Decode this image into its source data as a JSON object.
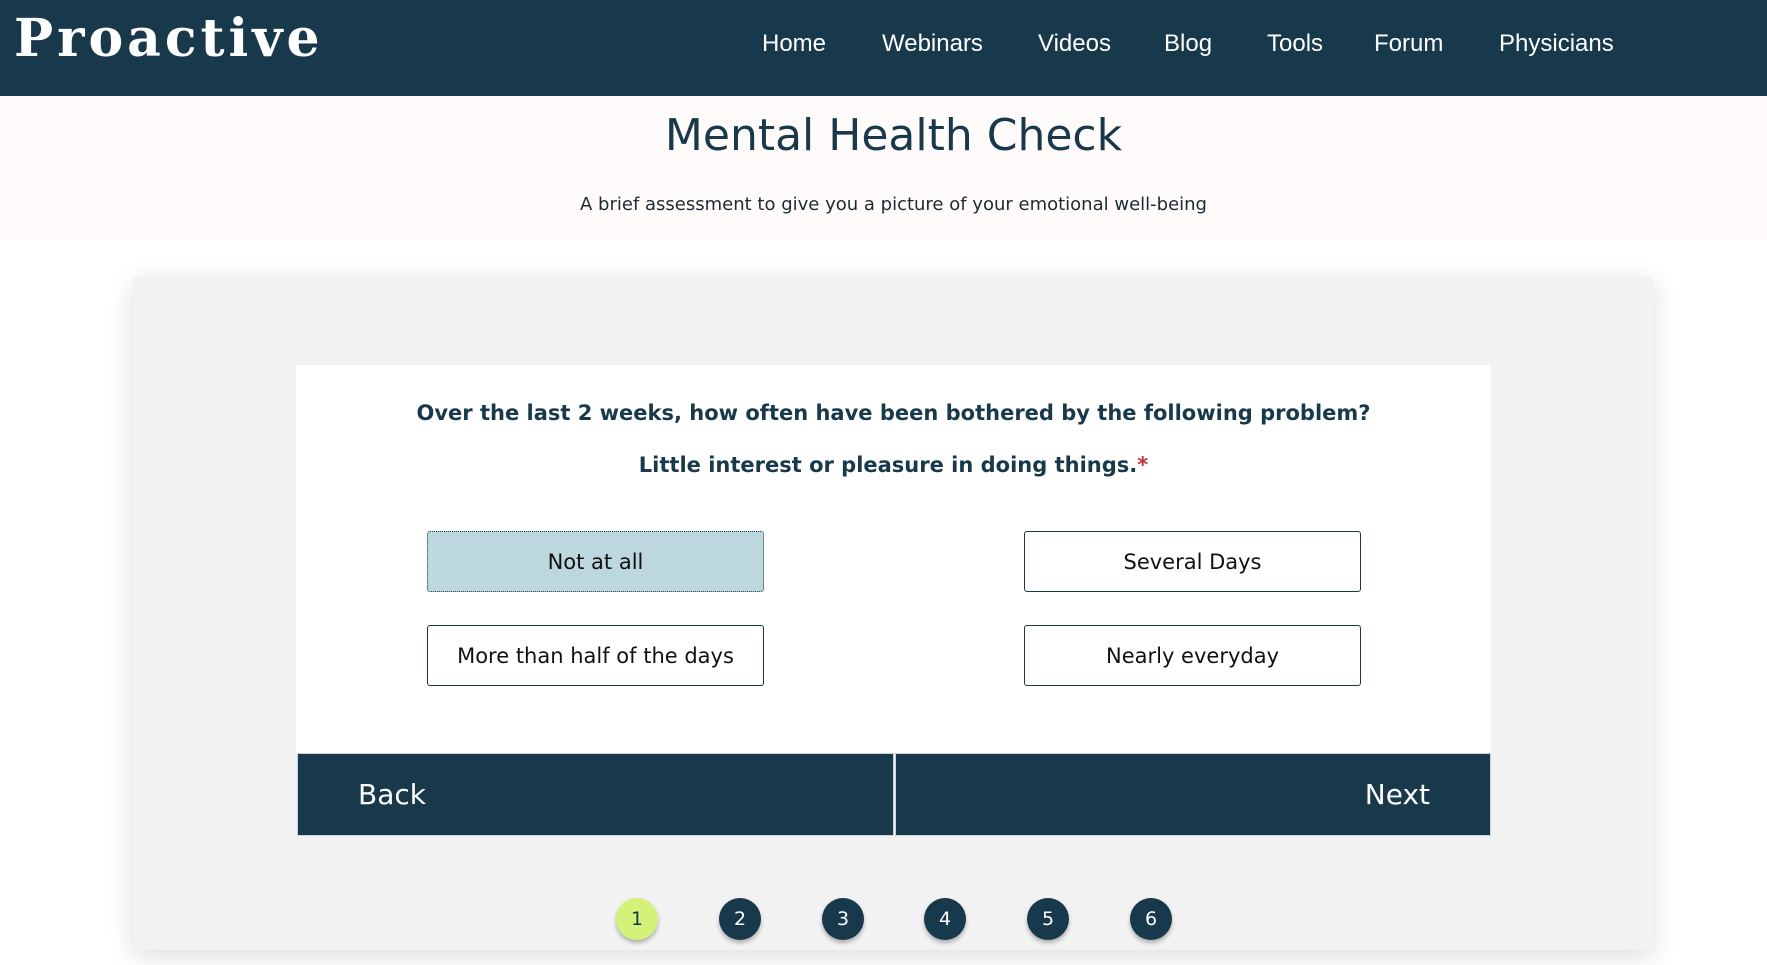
{
  "brand": {
    "logo": "Proactive"
  },
  "nav": {
    "items": [
      "Home",
      "Webinars",
      "Videos",
      "Blog",
      "Tools",
      "Forum",
      "Physicians"
    ]
  },
  "header": {
    "title": "Mental Health Check",
    "subtitle": "A brief assessment to give you a picture of your emotional well-being"
  },
  "question": {
    "text": "Over the last 2 weeks, how often have been bothered by the following problem?",
    "prompt": "Little interest or pleasure in doing things.",
    "required_marker": "*",
    "options": [
      "Not at all",
      "Several Days",
      "More than half of the days",
      "Nearly everyday"
    ],
    "selected_option": "Not at all"
  },
  "buttons": {
    "back": "Back",
    "next": "Next"
  },
  "steps": {
    "labels": [
      "1",
      "2",
      "3",
      "4",
      "5",
      "6"
    ],
    "current": "1"
  },
  "colors": {
    "primary": "#17394b",
    "selected_option": "#bcd7de",
    "active_step": "#d4f27a",
    "required": "#d0283a"
  }
}
